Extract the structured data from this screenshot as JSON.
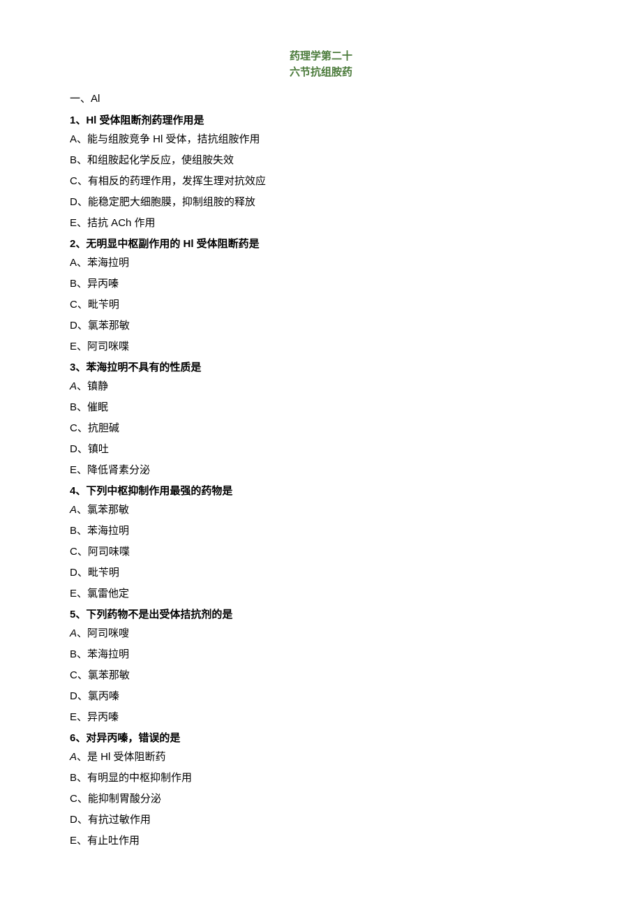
{
  "title_line1": "药理学第二十",
  "title_line2": "六节抗组胺药",
  "section_label": "一、Al",
  "questions": [
    {
      "q": "1、Hl 受体阻断剂药理作用是",
      "options": [
        {
          "letter": "A",
          "style": "arial",
          "text": "、能与组胺竞争 Hl 受体，拮抗组胺作用"
        },
        {
          "letter": "B",
          "style": "arial",
          "text": "、和组胺起化学反应，使组胺失效"
        },
        {
          "letter": "C",
          "style": "arial",
          "text": "、有相反的药理作用，发挥生理对抗效应"
        },
        {
          "letter": "D",
          "style": "arial",
          "text": "、能稳定肥大细胞膜，抑制组胺的释放"
        },
        {
          "letter": "E",
          "style": "plain",
          "text": "、拮抗 ACh 作用"
        }
      ]
    },
    {
      "q": "2、无明显中枢副作用的 Hl 受体阻断药是",
      "options": [
        {
          "letter": "A",
          "style": "arial",
          "text": "、苯海拉明"
        },
        {
          "letter": "B",
          "style": "arial",
          "text": "、异丙嗪"
        },
        {
          "letter": "C",
          "style": "arial",
          "text": "、毗苄明"
        },
        {
          "letter": "D",
          "style": "arial",
          "text": "、氯苯那敏"
        },
        {
          "letter": "E",
          "style": "arial",
          "text": "、阿司咪喋"
        }
      ]
    },
    {
      "q": "3、苯海拉明不具有的性质是",
      "options": [
        {
          "letter": "A",
          "style": "italic",
          "text": "、镇静"
        },
        {
          "letter": "B",
          "style": "arial",
          "text": "、催眠"
        },
        {
          "letter": "C",
          "style": "arial",
          "text": "、抗胆碱"
        },
        {
          "letter": "D",
          "style": "arial",
          "text": "、镇吐"
        },
        {
          "letter": "E",
          "style": "plain",
          "text": "、降低肾素分泌"
        }
      ]
    },
    {
      "q": "4、下列中枢抑制作用最强的药物是",
      "options": [
        {
          "letter": "A",
          "style": "italic",
          "text": "、氯苯那敏"
        },
        {
          "letter": "B",
          "style": "arial",
          "text": "、苯海拉明"
        },
        {
          "letter": "C",
          "style": "arial",
          "text": "、阿司味喋"
        },
        {
          "letter": "D",
          "style": "arial",
          "text": "、毗苄明"
        },
        {
          "letter": "E",
          "style": "arial",
          "text": "、氯雷他定"
        }
      ]
    },
    {
      "q": "5、下列药物不是出受体拮抗剂的是",
      "options": [
        {
          "letter": "A",
          "style": "italic",
          "text": "、阿司咪嗖"
        },
        {
          "letter": "B",
          "style": "arial",
          "text": "、苯海拉明"
        },
        {
          "letter": "C",
          "style": "arial",
          "text": "、氯苯那敏"
        },
        {
          "letter": "D",
          "style": "arial",
          "text": "、氯丙嗪"
        },
        {
          "letter": "E",
          "style": "arial",
          "text": "、异丙嗪"
        }
      ]
    },
    {
      "q": "6、对异丙嗪，错误的是",
      "options": [
        {
          "letter": "A",
          "style": "italic",
          "text": "、是 Hl 受体阻断药"
        },
        {
          "letter": "B",
          "style": "arial",
          "text": "、有明显的中枢抑制作用"
        },
        {
          "letter": "C",
          "style": "arial",
          "text": "、能抑制胃酸分泌"
        },
        {
          "letter": "D",
          "style": "arial",
          "text": "、有抗过敏作用"
        },
        {
          "letter": "E",
          "style": "plain",
          "text": "、有止吐作用"
        }
      ]
    }
  ]
}
